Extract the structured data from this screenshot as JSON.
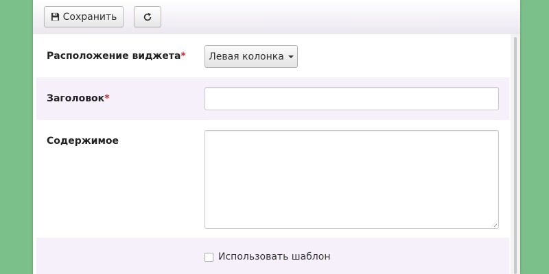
{
  "toolbar": {
    "save_label": "Сохранить",
    "save_icon": "floppy-disk-icon",
    "refresh_icon": "refresh-icon"
  },
  "form": {
    "widget_position": {
      "label": "Расположение виджета",
      "required_mark": "*",
      "selected_value": "Левая колонка"
    },
    "title": {
      "label": "Заголовок",
      "required_mark": "*",
      "value": ""
    },
    "content": {
      "label": "Содержимое",
      "value": ""
    },
    "use_template": {
      "label": "Использовать шаблон",
      "checked": false
    }
  },
  "colors": {
    "background": "#7bbf8b",
    "alt_row": "#f5f0fa",
    "required": "#d9232e"
  }
}
